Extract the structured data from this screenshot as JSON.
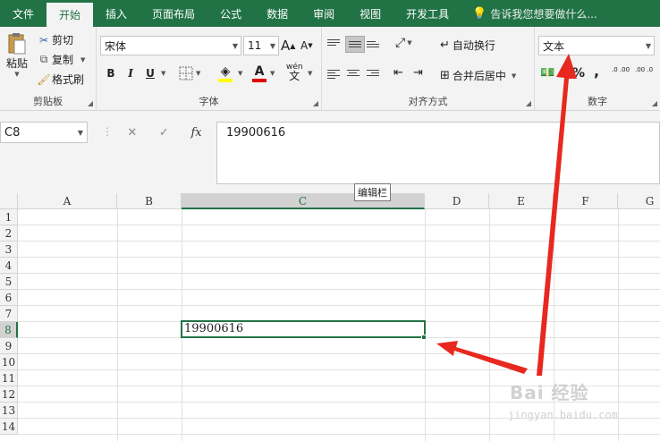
{
  "tabs": [
    "文件",
    "开始",
    "插入",
    "页面布局",
    "公式",
    "数据",
    "审阅",
    "视图",
    "开发工具"
  ],
  "active_tab": "开始",
  "tell_me": "告诉我您想要做什么...",
  "clipboard": {
    "paste": "粘贴",
    "cut": "剪切",
    "copy": "复制",
    "format_painter": "格式刷",
    "label": "剪贴板"
  },
  "font": {
    "name": "宋体",
    "size": "11",
    "grow": "A",
    "shrink": "A",
    "bold": "B",
    "italic": "I",
    "underline": "U",
    "label": "字体",
    "phonetic": "wén"
  },
  "alignment": {
    "wrap_text": "自动换行",
    "merge_center": "合并后居中",
    "label": "对齐方式"
  },
  "number": {
    "format": "文本",
    "label": "数字",
    "percent": "%",
    "comma": ",",
    "inc_dec": ".0 .00",
    "dec_dec": ".00 .0"
  },
  "name_box": "C8",
  "formula_value": "19900616",
  "tooltip": "编辑栏",
  "columns": [
    "A",
    "B",
    "C",
    "D",
    "E",
    "F",
    "G"
  ],
  "rows": [
    "1",
    "2",
    "3",
    "4",
    "5",
    "6",
    "7",
    "8",
    "9",
    "10",
    "11",
    "12",
    "13",
    "14"
  ],
  "selected_column": "C",
  "selected_row": "8",
  "cell_value": "19900616",
  "watermark": {
    "brand": "Bai 经验",
    "url": "jingyan.baidu.com"
  },
  "colors": {
    "excel_green": "#217346",
    "arrow_red": "#e8281f"
  }
}
